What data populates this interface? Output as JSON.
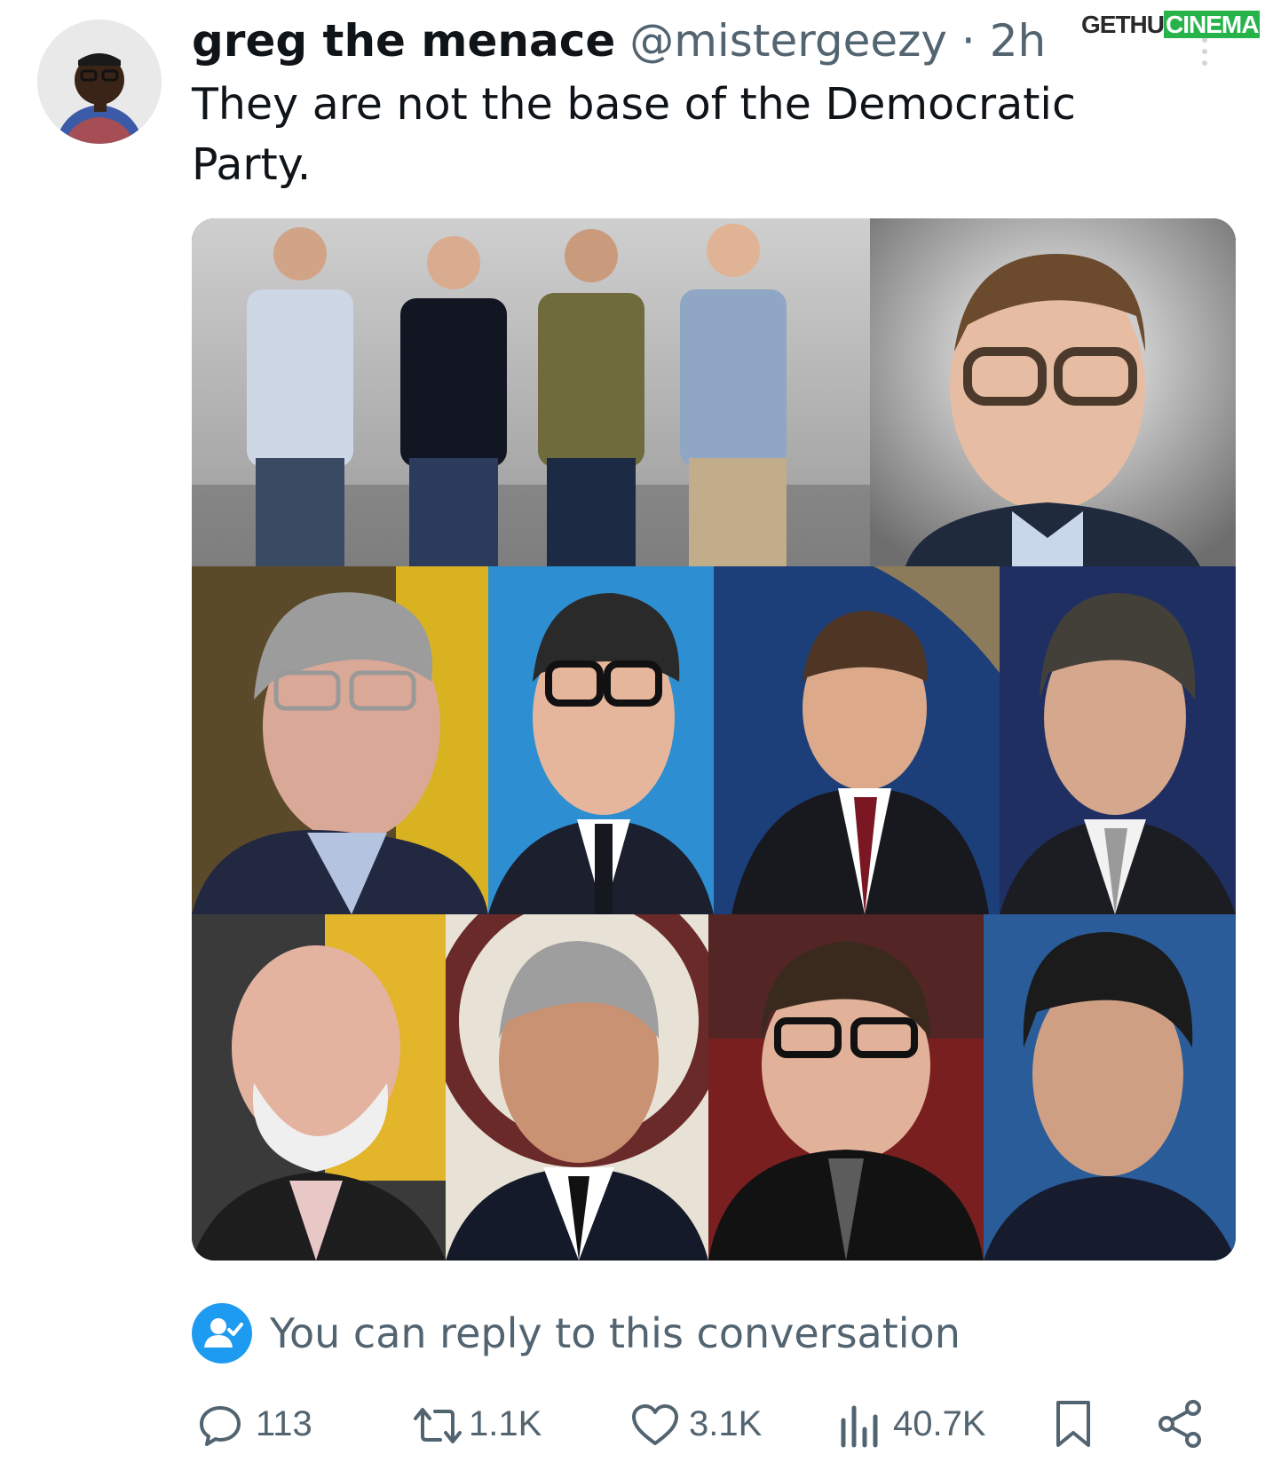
{
  "tweet": {
    "display_name": "greg the menace",
    "handle": "@mistergeezy",
    "separator": "·",
    "time": "2h",
    "text": "They are not the base of the Democratic Party."
  },
  "watermark": {
    "part1": "GETHU",
    "part2": "CINEMA"
  },
  "reply_notice": {
    "text": "You can reply to this conversation"
  },
  "actions": {
    "replies": "113",
    "reposts": "1.1K",
    "likes": "3.1K",
    "views": "40.7K"
  },
  "icons": [
    "reply-icon",
    "repost-icon",
    "like-icon",
    "views-icon",
    "bookmark-icon",
    "share-icon",
    "reply-permission-icon",
    "more-icon"
  ],
  "colors": {
    "accent": "#1d9bf0",
    "text": "#0f1419",
    "secondary": "#536471"
  }
}
